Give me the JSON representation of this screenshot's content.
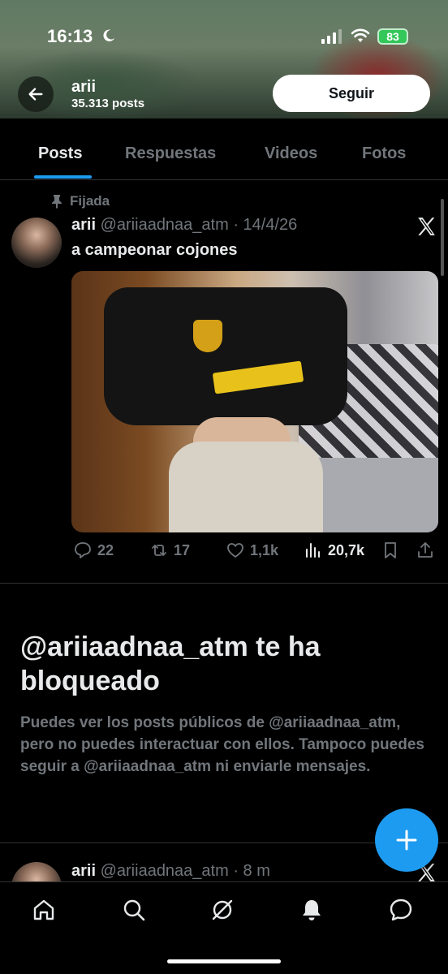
{
  "status_bar": {
    "time": "16:13",
    "battery": "83"
  },
  "header": {
    "name": "arii",
    "posts_count": "35.313 posts",
    "follow_label": "Seguir"
  },
  "tabs": [
    {
      "label": "Posts",
      "active": true
    },
    {
      "label": "Respuestas",
      "active": false
    },
    {
      "label": "Videos",
      "active": false
    },
    {
      "label": "Fotos",
      "active": false
    }
  ],
  "pinned_post": {
    "pinned_label": "Fijada",
    "author_name": "arii",
    "handle_and_date": "@ariiaadnaa_atm · 14/4/26",
    "text": "a campeonar cojones",
    "replies": "22",
    "reposts": "17",
    "likes": "1,1k",
    "views": "20,7k"
  },
  "blocked_notice": {
    "title": "@ariiaadnaa_atm te ha bloqueado",
    "body": "Puedes ver los posts públicos de @ariiaadnaa_atm, pero no puedes interactuar con ellos. Tampoco puedes seguir a @ariiaadnaa_atm ni enviarle mensajes."
  },
  "second_post": {
    "author_name": "arii",
    "handle_and_time": "@ariiaadnaa_atm · 8 m"
  },
  "icons": {
    "back": "arrow-left-icon",
    "pin": "pin-icon",
    "x_logo": "x-logo-icon",
    "reply": "reply-icon",
    "repost": "repost-icon",
    "like": "heart-icon",
    "views": "views-icon",
    "bookmark": "bookmark-icon",
    "share": "share-icon",
    "compose": "plus-icon",
    "nav": [
      "home-icon",
      "search-icon",
      "grok-icon",
      "bell-icon",
      "messages-icon"
    ]
  },
  "colors": {
    "accent": "#1d9bf0",
    "background": "#000000",
    "secondary_text": "#71767b",
    "primary_text": "#e7e9ea"
  }
}
